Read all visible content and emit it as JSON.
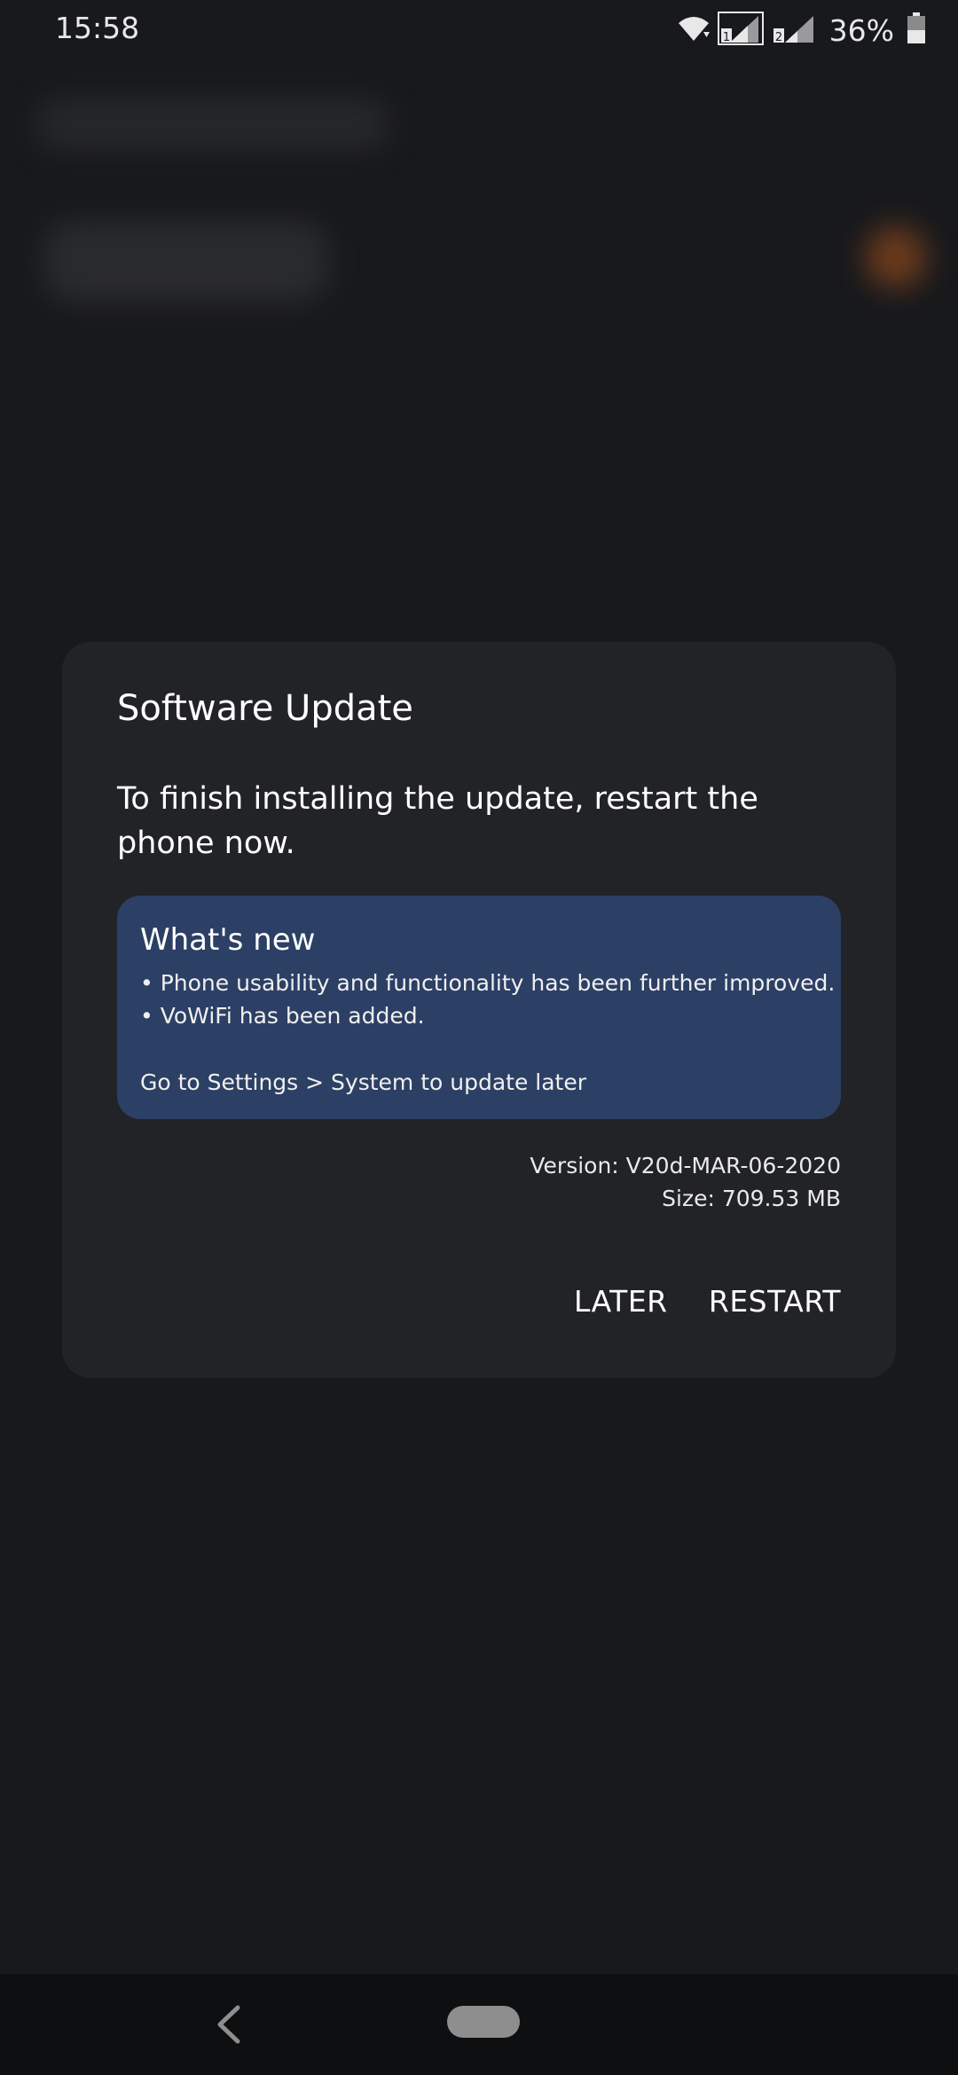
{
  "status_bar": {
    "time": "15:58",
    "battery_percent": "36%",
    "icons": [
      "wifi-icon",
      "sim1-signal-icon",
      "sim2-signal-icon",
      "battery-icon"
    ]
  },
  "dialog": {
    "title": "Software Update",
    "message": "To finish installing the update, restart the phone now.",
    "whats_new": {
      "title": "What's new",
      "items": [
        "• Phone usability and functionality has been further improved.",
        "• VoWiFi has been added."
      ],
      "later_hint": "Go to Settings > System to update later"
    },
    "version": "Version: V20d-MAR-06-2020",
    "size": "Size: 709.53 MB",
    "buttons": {
      "later": "LATER",
      "restart": "RESTART"
    }
  },
  "colors": {
    "background": "#18191c",
    "dialog": "#222327",
    "whats_new_box": "#2c3f64",
    "text": "#ffffff"
  },
  "nav": {
    "icons": [
      "back-icon",
      "home-pill-icon"
    ]
  }
}
